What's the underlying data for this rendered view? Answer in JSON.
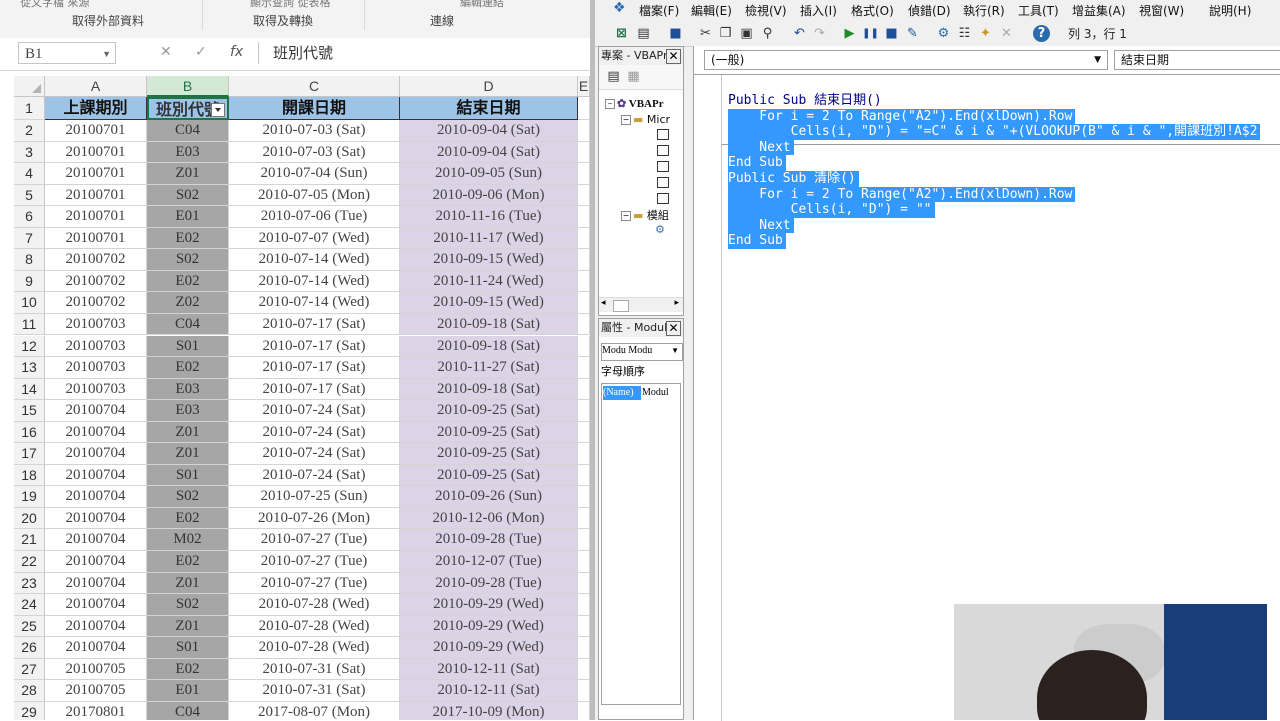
{
  "excel": {
    "ribbon": {
      "cut_left": "從文字檔   來源",
      "cut_mid": "顯示查詢   從表格",
      "cut_right": "編輯連結",
      "groups": [
        "取得外部資料",
        "取得及轉換",
        "連線"
      ]
    },
    "name_box": "B1",
    "formula_icons": {
      "cancel": "✕",
      "enter": "✓",
      "fx": "fx"
    },
    "formula_value": "班別代號",
    "columns": [
      "A",
      "B",
      "C",
      "D"
    ],
    "headers": [
      "上課期別",
      "班別代號",
      "開課日期",
      "結束日期"
    ],
    "rows": [
      {
        "n": "2",
        "a": "20100701",
        "b": "C04",
        "c": "2010-07-03 (Sat)",
        "d": "2010-09-04 (Sat)"
      },
      {
        "n": "3",
        "a": "20100701",
        "b": "E03",
        "c": "2010-07-03 (Sat)",
        "d": "2010-09-04 (Sat)"
      },
      {
        "n": "4",
        "a": "20100701",
        "b": "Z01",
        "c": "2010-07-04 (Sun)",
        "d": "2010-09-05 (Sun)"
      },
      {
        "n": "5",
        "a": "20100701",
        "b": "S02",
        "c": "2010-07-05 (Mon)",
        "d": "2010-09-06 (Mon)"
      },
      {
        "n": "6",
        "a": "20100701",
        "b": "E01",
        "c": "2010-07-06 (Tue)",
        "d": "2010-11-16 (Tue)"
      },
      {
        "n": "7",
        "a": "20100701",
        "b": "E02",
        "c": "2010-07-07 (Wed)",
        "d": "2010-11-17 (Wed)"
      },
      {
        "n": "8",
        "a": "20100702",
        "b": "S02",
        "c": "2010-07-14 (Wed)",
        "d": "2010-09-15 (Wed)"
      },
      {
        "n": "9",
        "a": "20100702",
        "b": "E02",
        "c": "2010-07-14 (Wed)",
        "d": "2010-11-24 (Wed)"
      },
      {
        "n": "10",
        "a": "20100702",
        "b": "Z02",
        "c": "2010-07-14 (Wed)",
        "d": "2010-09-15 (Wed)"
      },
      {
        "n": "11",
        "a": "20100703",
        "b": "C04",
        "c": "2010-07-17 (Sat)",
        "d": "2010-09-18 (Sat)"
      },
      {
        "n": "12",
        "a": "20100703",
        "b": "S01",
        "c": "2010-07-17 (Sat)",
        "d": "2010-09-18 (Sat)"
      },
      {
        "n": "13",
        "a": "20100703",
        "b": "E02",
        "c": "2010-07-17 (Sat)",
        "d": "2010-11-27 (Sat)"
      },
      {
        "n": "14",
        "a": "20100703",
        "b": "E03",
        "c": "2010-07-17 (Sat)",
        "d": "2010-09-18 (Sat)"
      },
      {
        "n": "15",
        "a": "20100704",
        "b": "E03",
        "c": "2010-07-24 (Sat)",
        "d": "2010-09-25 (Sat)"
      },
      {
        "n": "16",
        "a": "20100704",
        "b": "Z01",
        "c": "2010-07-24 (Sat)",
        "d": "2010-09-25 (Sat)"
      },
      {
        "n": "17",
        "a": "20100704",
        "b": "Z01",
        "c": "2010-07-24 (Sat)",
        "d": "2010-09-25 (Sat)"
      },
      {
        "n": "18",
        "a": "20100704",
        "b": "S01",
        "c": "2010-07-24 (Sat)",
        "d": "2010-09-25 (Sat)"
      },
      {
        "n": "19",
        "a": "20100704",
        "b": "S02",
        "c": "2010-07-25 (Sun)",
        "d": "2010-09-26 (Sun)"
      },
      {
        "n": "20",
        "a": "20100704",
        "b": "E02",
        "c": "2010-07-26 (Mon)",
        "d": "2010-12-06 (Mon)"
      },
      {
        "n": "21",
        "a": "20100704",
        "b": "M02",
        "c": "2010-07-27 (Tue)",
        "d": "2010-09-28 (Tue)"
      },
      {
        "n": "22",
        "a": "20100704",
        "b": "E02",
        "c": "2010-07-27 (Tue)",
        "d": "2010-12-07 (Tue)"
      },
      {
        "n": "23",
        "a": "20100704",
        "b": "Z01",
        "c": "2010-07-27 (Tue)",
        "d": "2010-09-28 (Tue)"
      },
      {
        "n": "24",
        "a": "20100704",
        "b": "S02",
        "c": "2010-07-28 (Wed)",
        "d": "2010-09-29 (Wed)"
      },
      {
        "n": "25",
        "a": "20100704",
        "b": "Z01",
        "c": "2010-07-28 (Wed)",
        "d": "2010-09-29 (Wed)"
      },
      {
        "n": "26",
        "a": "20100704",
        "b": "S01",
        "c": "2010-07-28 (Wed)",
        "d": "2010-09-29 (Wed)"
      },
      {
        "n": "27",
        "a": "20100705",
        "b": "E02",
        "c": "2010-07-31 (Sat)",
        "d": "2010-12-11 (Sat)"
      },
      {
        "n": "28",
        "a": "20100705",
        "b": "E01",
        "c": "2010-07-31 (Sat)",
        "d": "2010-12-11 (Sat)"
      },
      {
        "n": "29",
        "a": "20170801",
        "b": "C04",
        "c": "2017-08-07 (Mon)",
        "d": "2017-10-09 (Mon)"
      }
    ],
    "colors": {
      "header_fill": "#9dc3e6",
      "col_b_fill": "#a6a6a6",
      "col_d_fill": "#dcd3e6",
      "selected_col": "#217346"
    }
  },
  "vbe": {
    "menus": [
      "檔案(F)",
      "編輯(E)",
      "檢視(V)",
      "插入(I)",
      "格式(O)",
      "偵錯(D)",
      "執行(R)",
      "工具(T)",
      "增益集(A)",
      "視窗(W)",
      "說明(H)"
    ],
    "toolbar_icons": [
      "excel-icon",
      "insert-module-icon",
      "save-icon",
      "cut-icon",
      "copy-icon",
      "paste-icon",
      "find-icon",
      "undo-icon",
      "redo-icon",
      "run-icon",
      "break-icon",
      "reset-icon",
      "design-mode-icon",
      "project-explorer-icon",
      "properties-icon",
      "object-browser-icon",
      "toolbox-icon",
      "help-icon"
    ],
    "position": "列 3，行 1",
    "project_pane": {
      "title": "專案 - VBAPr",
      "root": "VBAPr",
      "folder": "Micr",
      "modules_folder": "模組"
    },
    "properties_pane": {
      "title": "屬性 - Modul",
      "object_combo": "Modu Modu",
      "tab": "字母順序",
      "name_key": "(Name)",
      "name_val": "Modul"
    },
    "object_combo": "(一般)",
    "proc_combo": "結束日期",
    "code_lines": [
      "Public Sub 結束日期()",
      "    For i = 2 To Range(\"A2\").End(xlDown).Row",
      "        Cells(i, \"D\") = \"=C\" & i & \"+(VLOOKUP(B\" & i & \",開課班別!A$2",
      "    Next",
      "End Sub",
      "Public Sub 清除()",
      "    For i = 2 To Range(\"A2\").End(xlDown).Row",
      "        Cells(i, \"D\") = \"\"",
      "    Next",
      "End Sub"
    ]
  }
}
